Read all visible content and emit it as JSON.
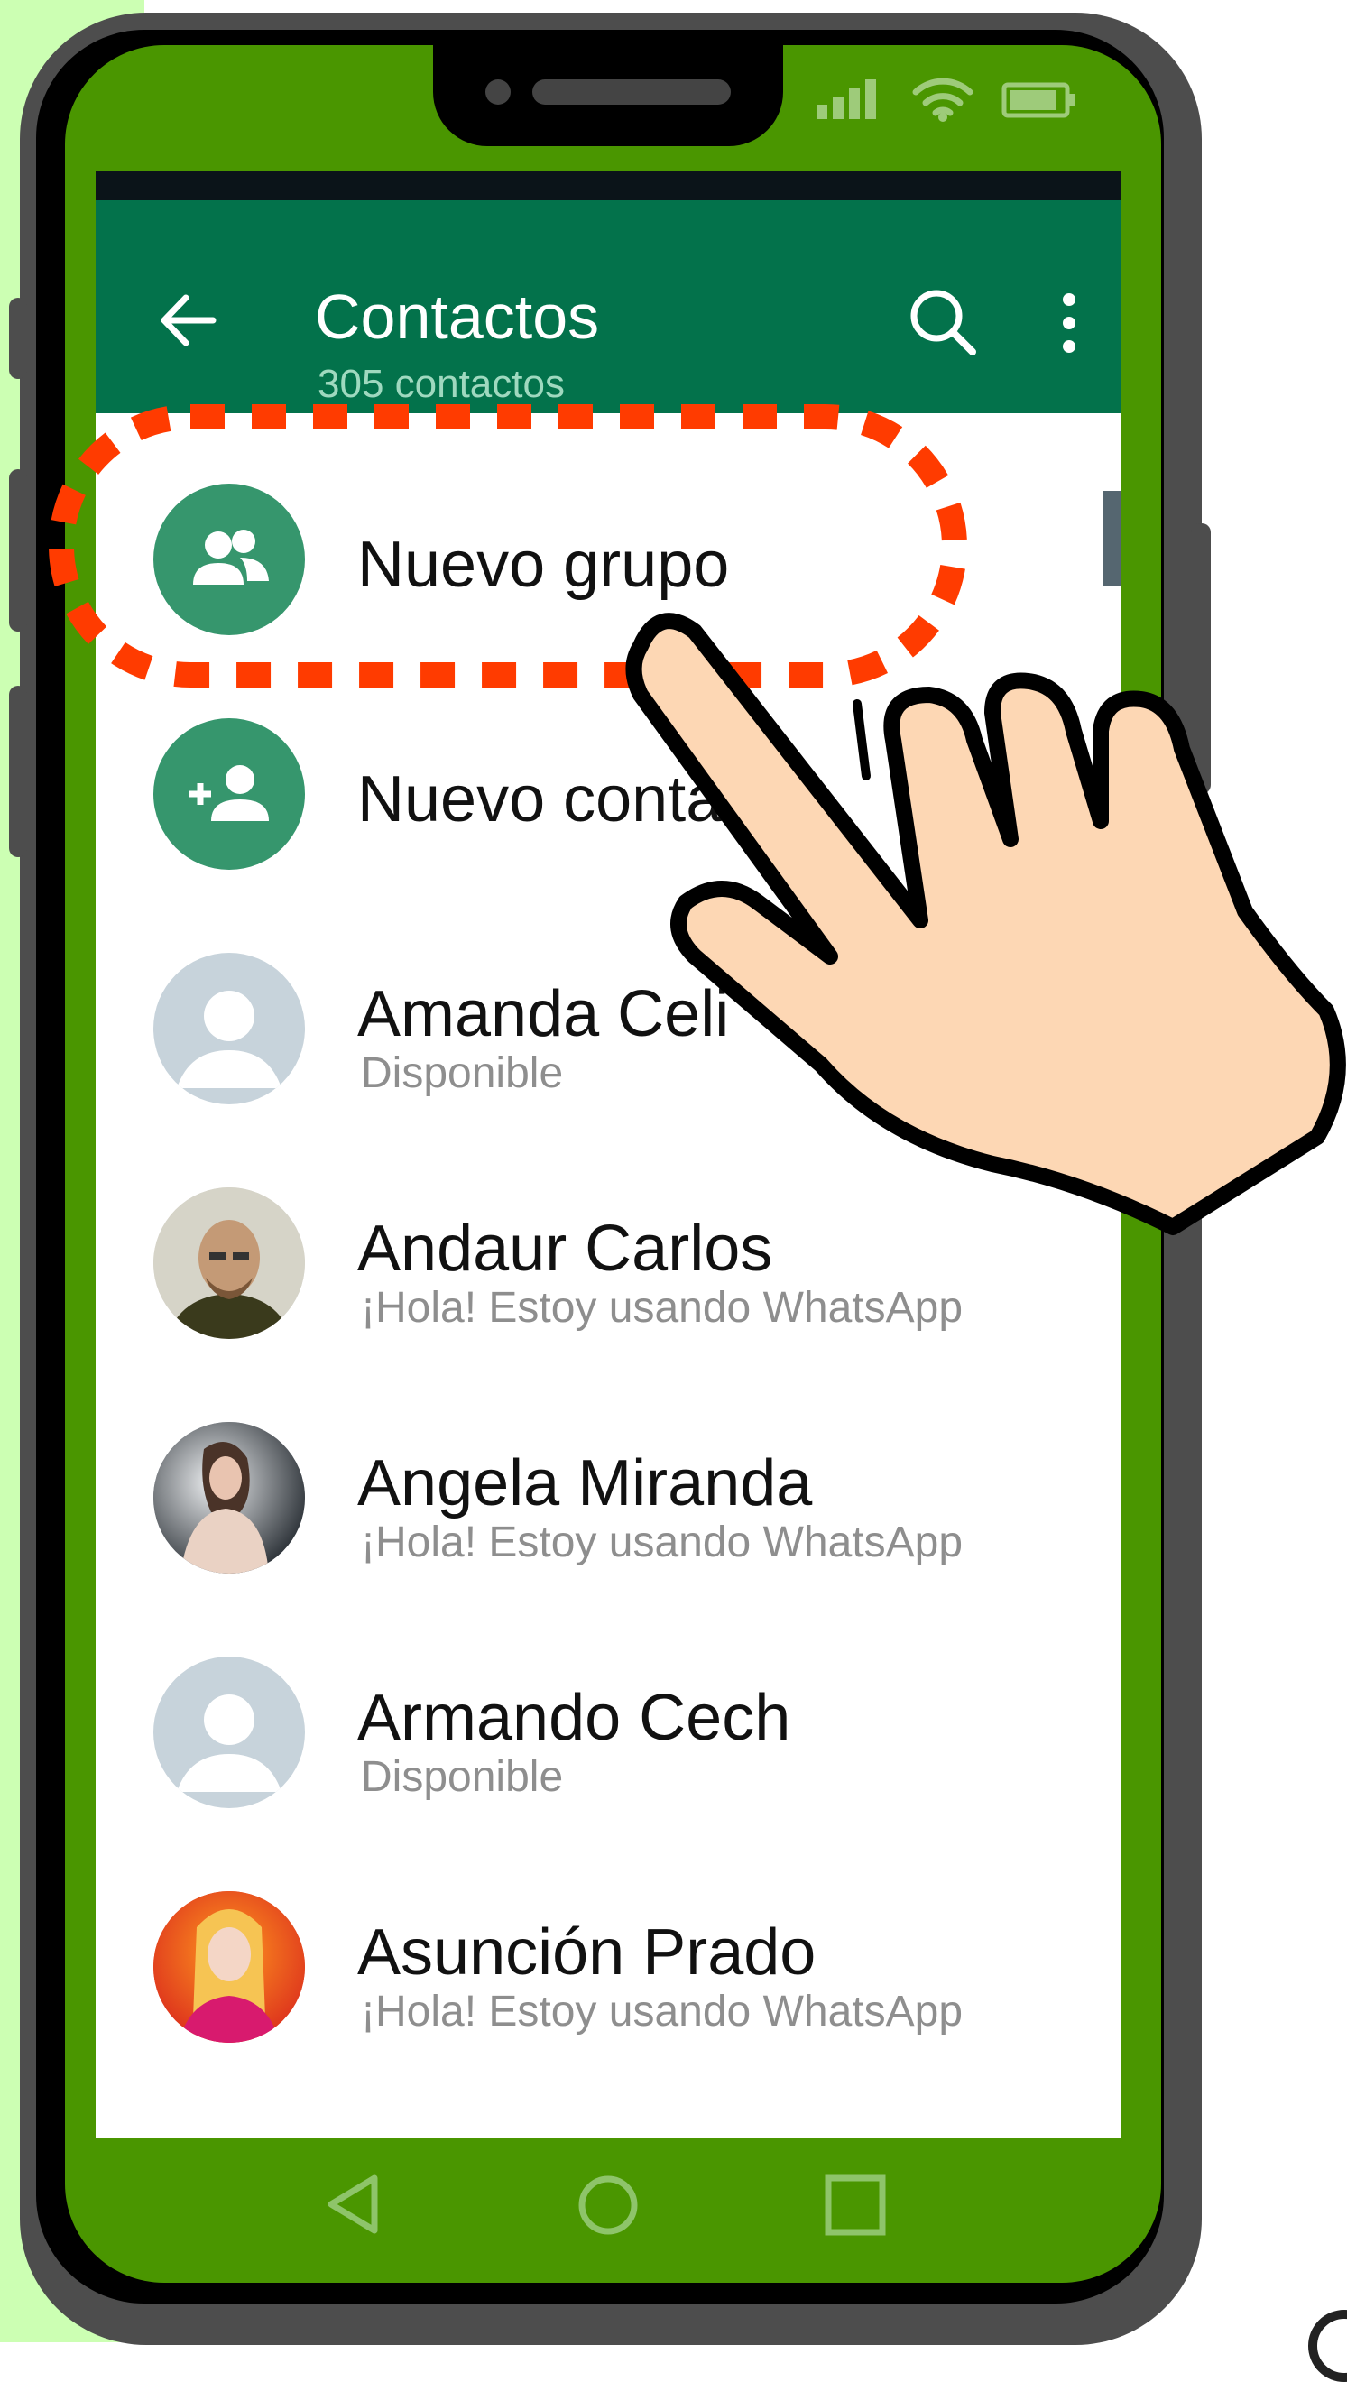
{
  "appbar": {
    "title": "Contactos",
    "subtitle": "305 contactos",
    "back_icon": "arrow-back-icon",
    "search_icon": "search-icon",
    "menu_icon": "more-vert-icon"
  },
  "actions": [
    {
      "label": "Nuevo grupo",
      "icon": "group-icon"
    },
    {
      "label": "Nuevo conta",
      "icon": "person-add-icon"
    }
  ],
  "contacts": [
    {
      "name": "Amanda Celi",
      "status": "Disponible"
    },
    {
      "name": "Andaur Carlos",
      "status": "¡Hola! Estoy usando WhatsApp"
    },
    {
      "name": "Angela Miranda",
      "status": "¡Hola! Estoy usando WhatsApp"
    },
    {
      "name": "Armando Cech",
      "status": "Disponible"
    },
    {
      "name": "Asunción Prado",
      "status": "¡Hola! Estoy usando WhatsApp"
    }
  ],
  "navbar": {
    "back": "triangle-back-icon",
    "home": "circle-home-icon",
    "recents": "square-recents-icon"
  },
  "colors": {
    "appbar": "#03724b",
    "accent": "#36966d",
    "phone_body": "#4a9600",
    "highlight": "#ff3b00",
    "hand": "#fdd7b4"
  }
}
